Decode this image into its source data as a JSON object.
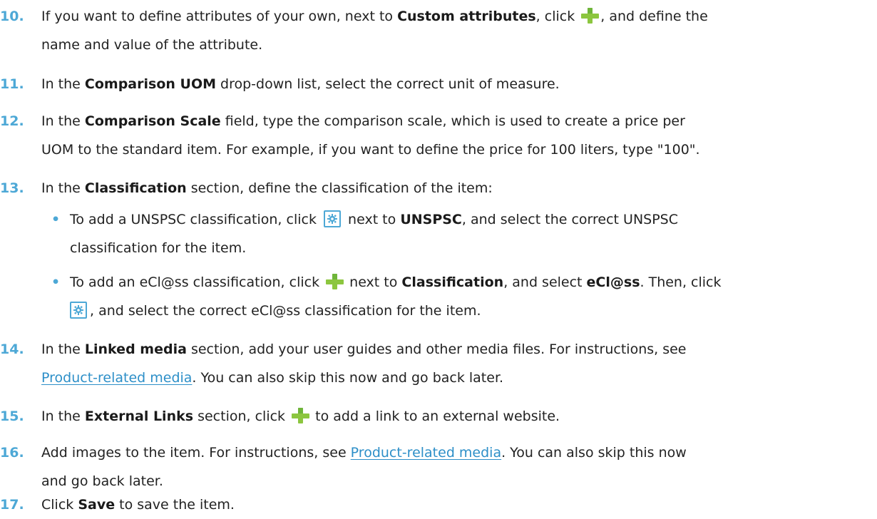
{
  "steps": {
    "s10": {
      "num": "10.",
      "line1_a": "If you want to define attributes of your own, next to ",
      "line1_b": "Custom attributes",
      "line1_c": ", click ",
      "line1_d": ", and define the",
      "line2": "name and value of the attribute."
    },
    "s11": {
      "num": "11.",
      "a": "In the ",
      "b": "Comparison UOM",
      "c": " drop-down list, select the correct unit of measure."
    },
    "s12": {
      "num": "12.",
      "a": "In the ",
      "b": "Comparison Scale",
      "c": " field, type the comparison scale, which is used to create a price per",
      "line2": "UOM to the standard item. For example, if you want to define the price for 100 liters, type \"100\"."
    },
    "s13": {
      "num": "13.",
      "a": "In the ",
      "b": "Classification",
      "c": " section, define the classification of the item:",
      "bullet1": {
        "a": "To add a UNSPSC classification, click ",
        "b": " next to ",
        "c": "UNSPSC",
        "d": ", and select the correct UNSPSC",
        "line2": "classification for the item."
      },
      "bullet2": {
        "a": "To add an eCl@ss classification, click ",
        "b": " next to ",
        "c": "Classification",
        "d": ", and select ",
        "e": "eCl@ss",
        "f": ". Then, click",
        "line2": ", and select the correct eCl@ss classification for the item."
      }
    },
    "s14": {
      "num": "14.",
      "a": "In the ",
      "b": "Linked media",
      "c": " section, add your user guides and other media files. For instructions, see",
      "link": "Product-related media",
      "d": ". You can also skip this now and go back later."
    },
    "s15": {
      "num": "15.",
      "a": "In the ",
      "b": "External Links",
      "c": " section, click ",
      "d": " to add a link to an external website."
    },
    "s16": {
      "num": "16.",
      "a": "Add images to the item. For instructions, see ",
      "link": "Product-related media",
      "b": ". You can also skip this now",
      "line2": "and go back later."
    },
    "s17": {
      "num": "17.",
      "a": "Click ",
      "b": "Save",
      "c": " to save the item."
    }
  },
  "icons": {
    "add": "plus-icon",
    "browse": "gear-icon"
  },
  "colors": {
    "step_number": "#4da8d6",
    "link": "#2d8fc8",
    "plus": "#8cc63f",
    "gear_border": "#4da8d6"
  }
}
